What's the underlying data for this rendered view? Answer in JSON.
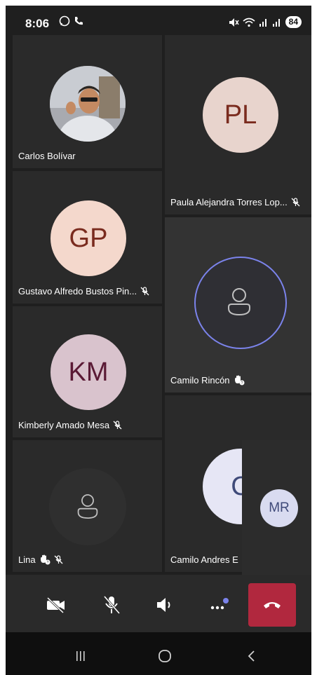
{
  "status_bar": {
    "time": "8:06",
    "battery": "84",
    "icons_left": [
      "whatsapp-icon",
      "phone-icon"
    ],
    "icons_right": [
      "mute-icon",
      "wifi-icon",
      "signal-icon",
      "signal-icon"
    ]
  },
  "participants": [
    {
      "name": "Carlos Bolívar",
      "type": "photo"
    },
    {
      "name": "Paula Alejandra Torres Lop...",
      "initials": "PL",
      "muted": true,
      "avatar_bg": "#e8d4cd",
      "initials_color": "#7a2b1e"
    },
    {
      "name": "Gustavo Alfredo Bustos Pin...",
      "initials": "GP",
      "muted": true,
      "avatar_bg": "#f4d8cc",
      "initials_color": "#7a2b1e"
    },
    {
      "name": "Camilo Rincón",
      "type": "placeholder",
      "speaking": true,
      "raised_hand": true
    },
    {
      "name": "Kimberly Amado Mesa",
      "initials": "KM",
      "muted": true,
      "avatar_bg": "#d9c3cd",
      "initials_color": "#5a1a35"
    },
    {
      "name": "Lina",
      "type": "placeholder",
      "raised_hand": true,
      "muted": true
    },
    {
      "name": "Camilo Andres E",
      "initials": "C",
      "avatar_bg": "#e6e6f5",
      "initials_color": "#3f4a79"
    }
  ],
  "self_view": {
    "initials": "MR"
  },
  "toolbar": {
    "buttons": [
      "video-off-icon",
      "mic-off-icon",
      "speaker-icon",
      "more-icon",
      "hang-up-icon"
    ],
    "accent": "#7b83eb",
    "hangup_color": "#b1283e"
  },
  "nav_bar": {
    "buttons": [
      "recent-apps-icon",
      "home-icon",
      "back-icon"
    ]
  }
}
